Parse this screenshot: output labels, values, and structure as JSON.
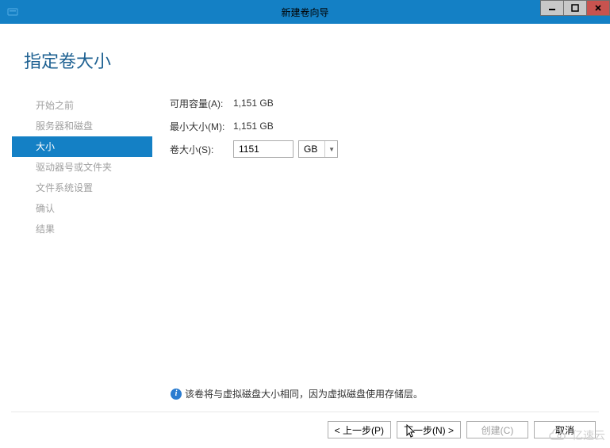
{
  "window": {
    "title": "新建卷向导"
  },
  "page": {
    "heading": "指定卷大小"
  },
  "sidebar": {
    "items": [
      {
        "label": "开始之前"
      },
      {
        "label": "服务器和磁盘"
      },
      {
        "label": "大小"
      },
      {
        "label": "驱动器号或文件夹"
      },
      {
        "label": "文件系统设置"
      },
      {
        "label": "确认"
      },
      {
        "label": "结果"
      }
    ],
    "active_index": 2
  },
  "form": {
    "available_label": "可用容量(A):",
    "available_value": "1,151 GB",
    "min_label": "最小大小(M):",
    "min_value": "1,151 GB",
    "size_label": "卷大小(S):",
    "size_value": "1151",
    "unit": "GB"
  },
  "info": {
    "text": "该卷将与虚拟磁盘大小相同，因为虚拟磁盘使用存储层。"
  },
  "buttons": {
    "prev": "< 上一步(P)",
    "next": "下一步(N) >",
    "create": "创建(C)",
    "cancel": "取消"
  },
  "watermark": "亿速云"
}
